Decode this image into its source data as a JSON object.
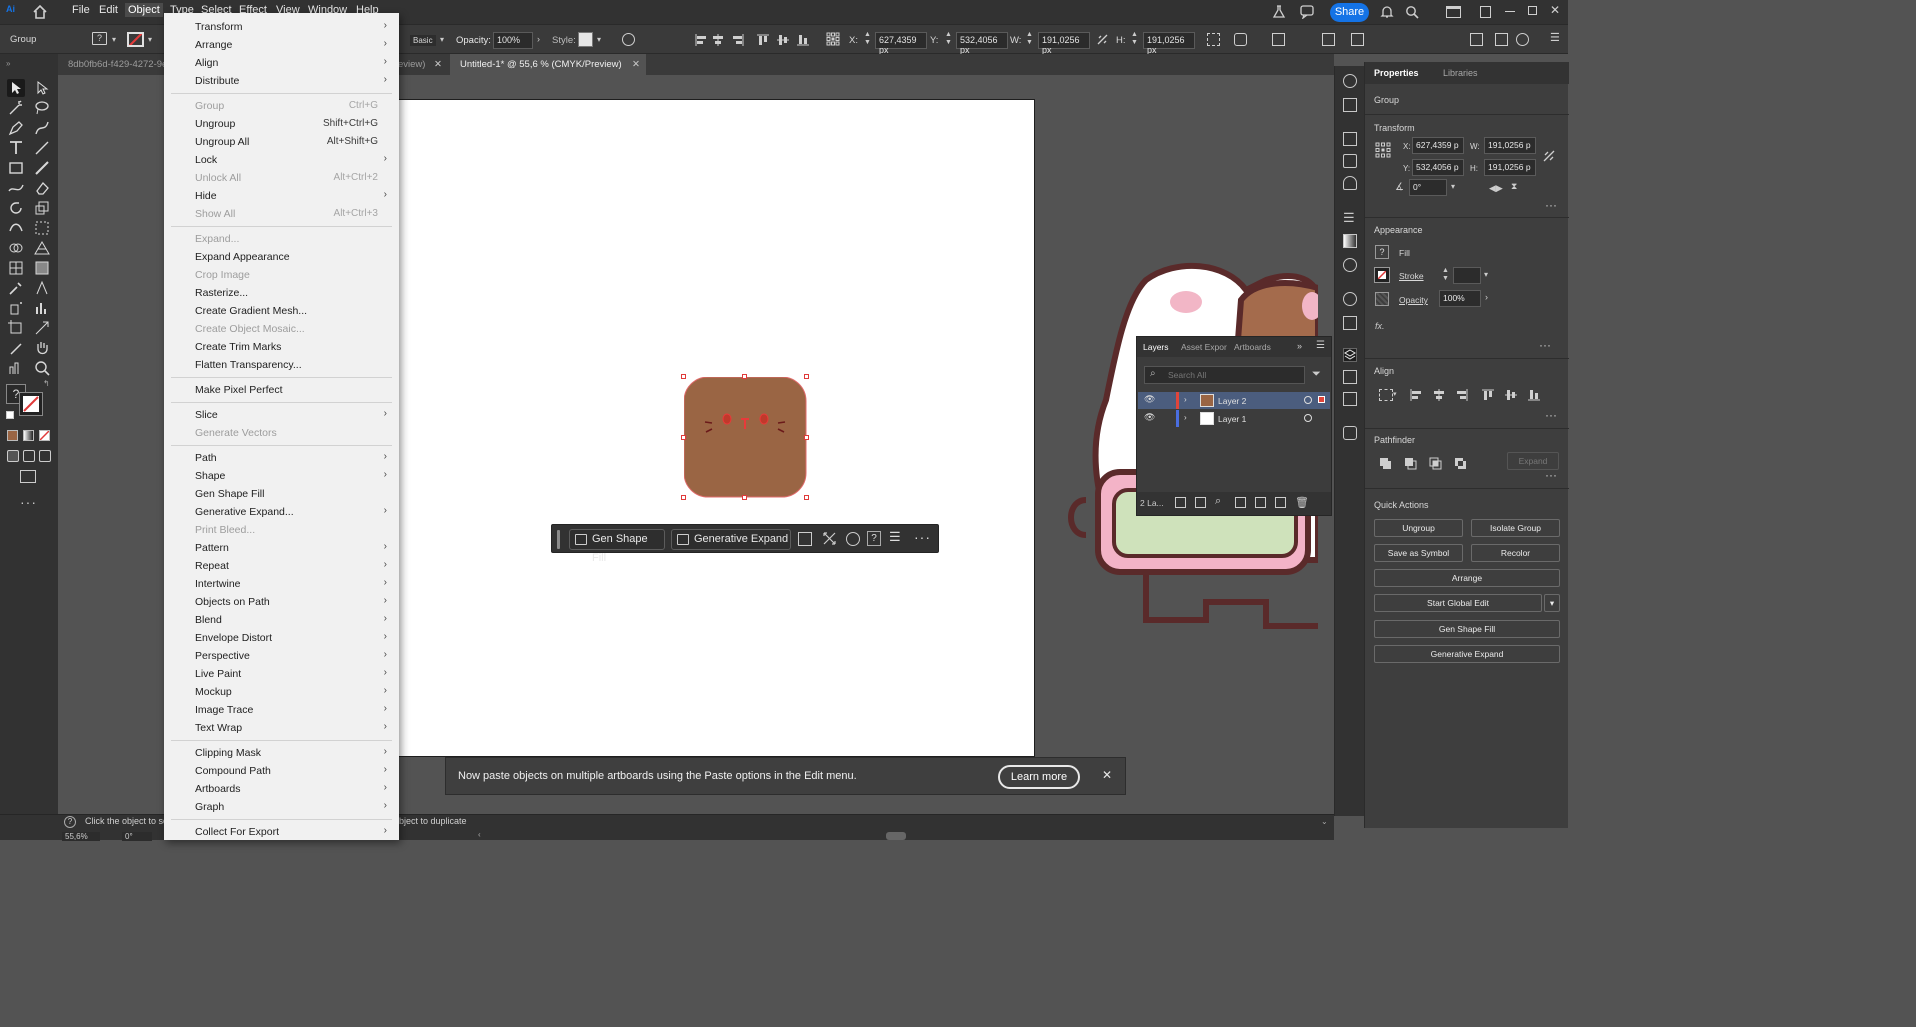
{
  "menubar": {
    "items": [
      "File",
      "Edit",
      "Object",
      "Type",
      "Select",
      "Effect",
      "View",
      "Window",
      "Help"
    ],
    "share_label": "Share"
  },
  "controlbar": {
    "selection_type": "Group",
    "brush": "Basic",
    "opacity_label": "Opacity:",
    "opacity_value": "100%",
    "style_label": "Style:",
    "x_label": "X:",
    "x_value": "627,4359 px",
    "y_label": "Y:",
    "y_value": "532,4056 px",
    "w_label": "W:",
    "w_value": "191,0256 px",
    "h_label": "H:",
    "h_value": "191,0256 px"
  },
  "tabs": [
    {
      "label": "8db0fb6d-f429-4272-9e",
      "active": false
    },
    {
      "label": "eview)",
      "active": false
    },
    {
      "label": "Untitled-1* @ 55,6 % (CMYK/Preview)",
      "active": true
    }
  ],
  "object_menu": {
    "items": [
      {
        "label": "Transform",
        "shortcut": "",
        "submenu": true,
        "disabled": false
      },
      {
        "label": "Arrange",
        "shortcut": "",
        "submenu": true,
        "disabled": false
      },
      {
        "label": "Align",
        "shortcut": "",
        "submenu": true,
        "disabled": false
      },
      {
        "label": "Distribute",
        "shortcut": "",
        "submenu": true,
        "disabled": false
      },
      {
        "sep": true
      },
      {
        "label": "Group",
        "shortcut": "Ctrl+G",
        "submenu": false,
        "disabled": true
      },
      {
        "label": "Ungroup",
        "shortcut": "Shift+Ctrl+G",
        "submenu": false,
        "disabled": false
      },
      {
        "label": "Ungroup All",
        "shortcut": "Alt+Shift+G",
        "submenu": false,
        "disabled": false
      },
      {
        "label": "Lock",
        "shortcut": "",
        "submenu": true,
        "disabled": false
      },
      {
        "label": "Unlock All",
        "shortcut": "Alt+Ctrl+2",
        "submenu": false,
        "disabled": true
      },
      {
        "label": "Hide",
        "shortcut": "",
        "submenu": true,
        "disabled": false
      },
      {
        "label": "Show All",
        "shortcut": "Alt+Ctrl+3",
        "submenu": false,
        "disabled": true
      },
      {
        "sep": true
      },
      {
        "label": "Expand...",
        "shortcut": "",
        "submenu": false,
        "disabled": true
      },
      {
        "label": "Expand Appearance",
        "shortcut": "",
        "submenu": false,
        "disabled": false
      },
      {
        "label": "Crop Image",
        "shortcut": "",
        "submenu": false,
        "disabled": true
      },
      {
        "label": "Rasterize...",
        "shortcut": "",
        "submenu": false,
        "disabled": false
      },
      {
        "label": "Create Gradient Mesh...",
        "shortcut": "",
        "submenu": false,
        "disabled": false
      },
      {
        "label": "Create Object Mosaic...",
        "shortcut": "",
        "submenu": false,
        "disabled": true
      },
      {
        "label": "Create Trim Marks",
        "shortcut": "",
        "submenu": false,
        "disabled": false
      },
      {
        "label": "Flatten Transparency...",
        "shortcut": "",
        "submenu": false,
        "disabled": false
      },
      {
        "sep": true
      },
      {
        "label": "Make Pixel Perfect",
        "shortcut": "",
        "submenu": false,
        "disabled": false
      },
      {
        "sep": true
      },
      {
        "label": "Slice",
        "shortcut": "",
        "submenu": true,
        "disabled": false
      },
      {
        "label": "Generate Vectors",
        "shortcut": "",
        "submenu": false,
        "disabled": true
      },
      {
        "sep": true
      },
      {
        "label": "Path",
        "shortcut": "",
        "submenu": true,
        "disabled": false
      },
      {
        "label": "Shape",
        "shortcut": "",
        "submenu": true,
        "disabled": false
      },
      {
        "label": "Gen Shape Fill",
        "shortcut": "",
        "submenu": false,
        "disabled": false
      },
      {
        "label": "Generative Expand...",
        "shortcut": "",
        "submenu": true,
        "disabled": false
      },
      {
        "label": "Print Bleed...",
        "shortcut": "",
        "submenu": false,
        "disabled": true
      },
      {
        "label": "Pattern",
        "shortcut": "",
        "submenu": true,
        "disabled": false
      },
      {
        "label": "Repeat",
        "shortcut": "",
        "submenu": true,
        "disabled": false
      },
      {
        "label": "Intertwine",
        "shortcut": "",
        "submenu": true,
        "disabled": false
      },
      {
        "label": "Objects on Path",
        "shortcut": "",
        "submenu": true,
        "disabled": false
      },
      {
        "label": "Blend",
        "shortcut": "",
        "submenu": true,
        "disabled": false
      },
      {
        "label": "Envelope Distort",
        "shortcut": "",
        "submenu": true,
        "disabled": false
      },
      {
        "label": "Perspective",
        "shortcut": "",
        "submenu": true,
        "disabled": false
      },
      {
        "label": "Live Paint",
        "shortcut": "",
        "submenu": true,
        "disabled": false
      },
      {
        "label": "Mockup",
        "shortcut": "",
        "submenu": true,
        "disabled": false
      },
      {
        "label": "Image Trace",
        "shortcut": "",
        "submenu": true,
        "disabled": false
      },
      {
        "label": "Text Wrap",
        "shortcut": "",
        "submenu": true,
        "disabled": false
      },
      {
        "sep": true
      },
      {
        "label": "Clipping Mask",
        "shortcut": "",
        "submenu": true,
        "disabled": false
      },
      {
        "label": "Compound Path",
        "shortcut": "",
        "submenu": true,
        "disabled": false
      },
      {
        "label": "Artboards",
        "shortcut": "",
        "submenu": true,
        "disabled": false
      },
      {
        "label": "Graph",
        "shortcut": "",
        "submenu": true,
        "disabled": false
      },
      {
        "sep": true
      },
      {
        "label": "Collect For Export",
        "shortcut": "",
        "submenu": true,
        "disabled": false
      }
    ]
  },
  "context_bar": {
    "gen_shape_fill": "Gen Shape Fill",
    "generative_expand": "Generative Expand"
  },
  "properties": {
    "tab_properties": "Properties",
    "tab_libraries": "Libraries",
    "selection": "Group",
    "transform_title": "Transform",
    "x_label": "X:",
    "x_value": "627,4359 p",
    "y_label": "Y:",
    "y_value": "532,4056 p",
    "w_label": "W:",
    "w_value": "191,0256 p",
    "h_label": "H:",
    "h_value": "191,0256 p",
    "angle_value": "0°",
    "appearance_title": "Appearance",
    "fill_label": "Fill",
    "stroke_label": "Stroke",
    "opacity_label": "Opacity",
    "opacity_value": "100%",
    "align_title": "Align",
    "pathfinder_title": "Pathfinder",
    "expand_label": "Expand",
    "quick_actions_title": "Quick Actions",
    "buttons": {
      "ungroup": "Ungroup",
      "isolate_group": "Isolate Group",
      "save_as_symbol": "Save as Symbol",
      "recolor": "Recolor",
      "arrange": "Arrange",
      "start_global_edit": "Start Global Edit",
      "gen_shape_fill": "Gen Shape Fill",
      "generative_expand": "Generative Expand"
    }
  },
  "layers_panel": {
    "tabs": [
      "Layers",
      "Asset Expor",
      "Artboards"
    ],
    "search_placeholder": "Search All",
    "layers": [
      {
        "name": "Layer 2",
        "selected": true,
        "color": "#e0453a"
      },
      {
        "name": "Layer 1",
        "selected": false,
        "color": "#4a6ee0"
      }
    ],
    "count_label": "2 La..."
  },
  "notification": {
    "message": "Now paste objects on multiple artboards using the Paste options in the Edit menu.",
    "learn_more": "Learn more"
  },
  "status": {
    "hint": "Click the object to se",
    "hint2": "bject to duplicate",
    "zoom": "55,6%",
    "rotation": "0°"
  },
  "colors": {
    "accent": "#1473e6",
    "cat_face": "#9a6544",
    "selection": "#e03a3a",
    "menu_bg": "#f1f1f1"
  }
}
